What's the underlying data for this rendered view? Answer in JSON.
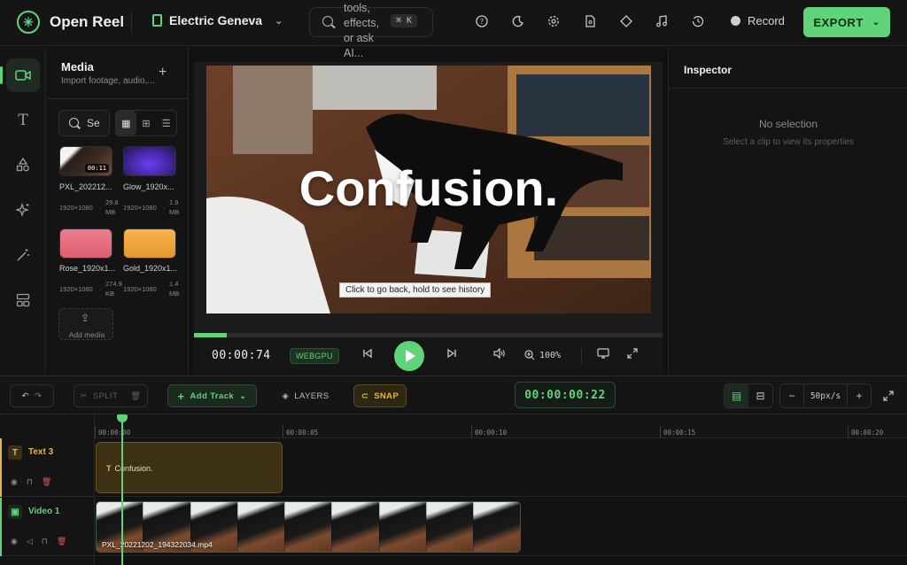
{
  "app": {
    "name": "Open Reel",
    "project_name": "Electric Geneva"
  },
  "search": {
    "placeholder": "tools, effects, or ask AI...",
    "shortcut": "⌘ K"
  },
  "header_icons": [
    "help-icon",
    "moon-icon",
    "settings-icon",
    "file-icon",
    "diamond-icon",
    "music-icon",
    "history-icon"
  ],
  "record": {
    "label": "Record"
  },
  "export": {
    "label": "EXPORT"
  },
  "rail": {
    "items": [
      "video",
      "text",
      "shapes",
      "effects",
      "magic",
      "layout"
    ],
    "active": "video"
  },
  "media": {
    "title": "Media",
    "subtitle": "Import footage, audio,...",
    "search_value": "Se",
    "add_label": "Add media",
    "items": [
      {
        "name": "PXL_202212...",
        "dims": "1920×1080",
        "size": "29.8 MB",
        "duration": "00:11",
        "color": "#3a2b22"
      },
      {
        "name": "Glow_1920x...",
        "dims": "1920×1080",
        "size": "1.9 MB",
        "color": "#4a2bb0"
      },
      {
        "name": "Rose_1920x1...",
        "dims": "1920×1080",
        "size": "274.9 KB",
        "color": "#e36b7c"
      },
      {
        "name": "Gold_1920x1...",
        "dims": "1920×1080",
        "size": "1.4 MB",
        "color": "#eda43a"
      }
    ]
  },
  "preview": {
    "overlay_text": "Confusion.",
    "tooltip": "Click to go back, hold to see history",
    "progress": 0.07
  },
  "transport": {
    "timecode": "00:00:74",
    "renderer": "WEBGPU",
    "zoom": "100%"
  },
  "inspector": {
    "title": "Inspector",
    "empty_title": "No selection",
    "empty_hint": "Select a clip to view its properties"
  },
  "timeline": {
    "split_label": "SPLIT",
    "add_track_label": "Add Track",
    "layers_label": "LAYERS",
    "snap_label": "SNAP",
    "timecode": "00:00:00:22",
    "zoom_value": "50px/s",
    "ruler": [
      "00:00:00",
      "00:00:05",
      "00:00:10",
      "00:00:15",
      "00:00:20"
    ],
    "tracks": [
      {
        "name": "Text 3",
        "type": "text",
        "clip_label": "Confusion.",
        "color": "#e3b34a"
      },
      {
        "name": "Video 1",
        "type": "video",
        "clip_label": "PXL_20221202_194322034.mp4",
        "color": "#5fd47a"
      }
    ]
  },
  "colors": {
    "accent": "#5fd47a",
    "text_track": "#e3b34a"
  }
}
